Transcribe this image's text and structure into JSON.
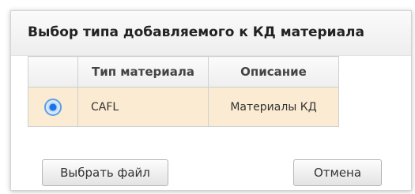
{
  "dialog": {
    "title": "Выбор типа добавляемого к КД материала",
    "table": {
      "headers": [
        "",
        "Тип материала",
        "Описание"
      ],
      "rows": [
        {
          "selected": true,
          "type": "CAFL",
          "description": "Материалы КД"
        }
      ]
    },
    "buttons": {
      "choose_file": "Выбрать файл",
      "cancel": "Отмена"
    }
  }
}
